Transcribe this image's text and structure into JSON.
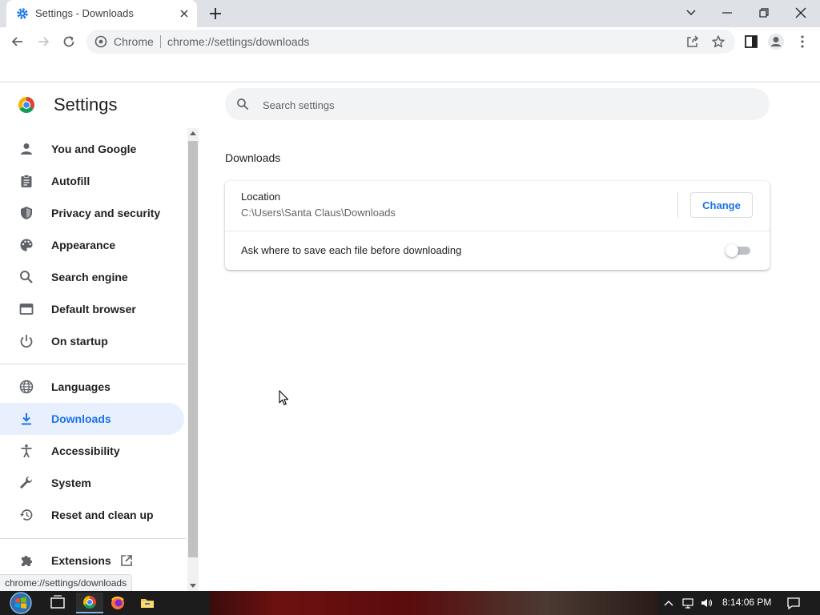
{
  "browser": {
    "tab_title": "Settings - Downloads",
    "omnibox_chip": "Chrome",
    "url": "chrome://settings/downloads"
  },
  "settings": {
    "title": "Settings",
    "search_placeholder": "Search settings",
    "nav": [
      {
        "label": "You and Google",
        "icon": "person-icon"
      },
      {
        "label": "Autofill",
        "icon": "clipboard-icon"
      },
      {
        "label": "Privacy and security",
        "icon": "shield-icon"
      },
      {
        "label": "Appearance",
        "icon": "palette-icon"
      },
      {
        "label": "Search engine",
        "icon": "search-icon"
      },
      {
        "label": "Default browser",
        "icon": "browser-window-icon"
      },
      {
        "label": "On startup",
        "icon": "power-icon"
      },
      {
        "label": "Languages",
        "icon": "globe-icon"
      },
      {
        "label": "Downloads",
        "icon": "download-icon",
        "active": true
      },
      {
        "label": "Accessibility",
        "icon": "accessibility-icon"
      },
      {
        "label": "System",
        "icon": "wrench-icon"
      },
      {
        "label": "Reset and clean up",
        "icon": "restore-icon"
      },
      {
        "label": "Extensions",
        "icon": "puzzle-icon"
      }
    ]
  },
  "downloads": {
    "section_title": "Downloads",
    "location_label": "Location",
    "location_path": "C:\\Users\\Santa Claus\\Downloads",
    "change_button": "Change",
    "ask_label": "Ask where to save each file before downloading",
    "ask_enabled": false
  },
  "status_tip": "chrome://settings/downloads",
  "taskbar": {
    "clock": "8:14:06 PM"
  },
  "colors": {
    "accent": "#1a73e8",
    "active_nav_bg": "#e8f0fe",
    "tab_strip": "#dee1e6"
  }
}
